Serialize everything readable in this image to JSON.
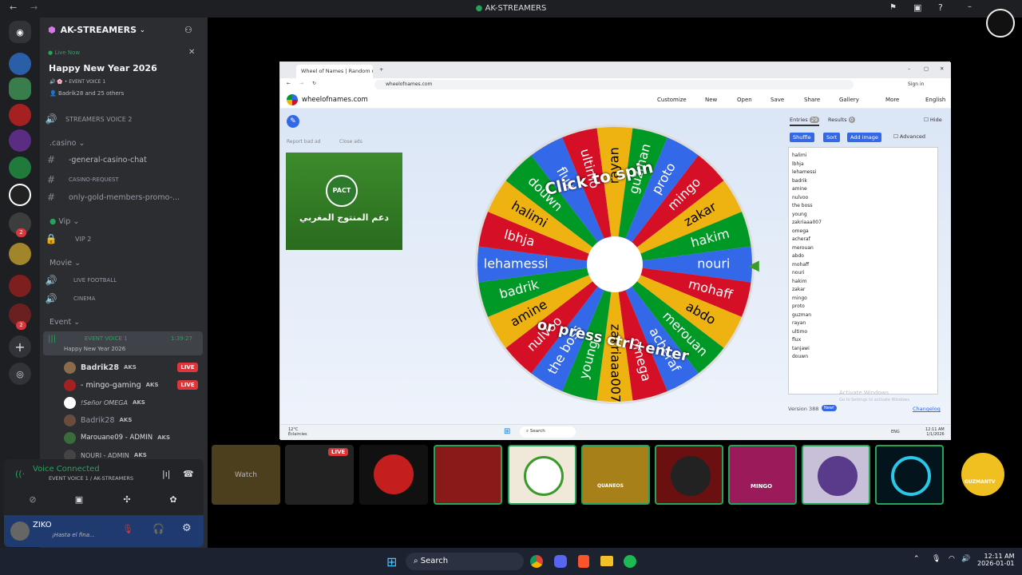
{
  "window": {
    "title": "AK-STREAMERS"
  },
  "server": {
    "name": "AK-STREAMERS"
  },
  "live_now": {
    "status": "Live Now",
    "event_title": "Happy New Year 2026",
    "channel": "EVENT VOICE 1",
    "participants": "Badrik28 and 25 others"
  },
  "channels": {
    "streamers_voice": "STREAMERS VOICE 2",
    "casino_category": ".casino",
    "casino_chat": "-general-casino-chat",
    "casino_request": "CASINO-REQUEST",
    "gold_promo": "only-gold-members-promo-...",
    "vip_category": "Vip",
    "vip2": "VIP 2",
    "movie_category": "Movie",
    "live_football": "LIVE FOOTBALL",
    "cinema": "CINEMA",
    "event_category": "Event",
    "event_voice": "EVENT VOICE 1",
    "event_timer": "1:39:27",
    "event_subtitle": "Happy New Year 2026"
  },
  "voice_users": [
    {
      "name": "Badrik28",
      "tag": "AKS",
      "live": "LIVE"
    },
    {
      "name": "- mingo-gaming",
      "tag": "AKS",
      "live": "LIVE"
    },
    {
      "name": "!Señor OMEGA",
      "tag": "AKS"
    },
    {
      "name": "Badrik28",
      "tag": "AKS"
    },
    {
      "name": "Marouane09 - ADMIN",
      "tag": "AKS"
    },
    {
      "name": "NOURI - ADMIN",
      "tag": "AKS"
    }
  ],
  "voice_panel": {
    "status": "Voice Connected",
    "channel": "EVENT VOICE 1 / AK-STREAMERS",
    "username": "ZIKO",
    "user_status": "¡Hasta el fina..."
  },
  "browser": {
    "tab": "Wheel of Names | Random nam",
    "url": "wheelofnames.com",
    "site": "wheelofnames.com",
    "sign_in": "Sign in",
    "menu": [
      "Customize",
      "New",
      "Open",
      "Save",
      "Share",
      "Gallery",
      "More",
      "English"
    ],
    "report_ad": "Report bad ad",
    "close_ads": "Close ads",
    "ad_title": "دعم المنتوج المغربي",
    "ad_brand": "PACT",
    "wheel_text_top": "Click to spin",
    "wheel_text_bottom": "or press ctrl+enter",
    "tabs": {
      "entries": "Entries",
      "entries_count": "29",
      "results": "Results",
      "results_count": "0",
      "hide": "Hide"
    },
    "buttons": {
      "shuffle": "Shuffle",
      "sort": "Sort",
      "add_image": "Add image",
      "advanced": "Advanced"
    },
    "entries": [
      "halimi",
      "lbhja",
      "lehamessi",
      "badrik",
      "amine",
      "nulvoo",
      "the boss",
      "young",
      "zakriaaa007",
      "omega",
      "acheraf",
      "merouan",
      "abdo",
      "mohaff",
      "nouri",
      "hakim",
      "zakar",
      "mingo",
      "proto",
      "guzman",
      "rayan",
      "ultimo",
      "flux",
      "tanjawi",
      "douwn"
    ],
    "version": "Version 388",
    "version_badge": "New!",
    "changelog": "Changelog",
    "activate": "Activate Windows",
    "activate_sub": "Go to Settings to activate Windows.",
    "inner_search": "Search",
    "inner_weather": "12°C",
    "inner_weather_sub": "Éclaircies",
    "inner_lang": "ENG",
    "inner_time": "12:11 AM",
    "inner_date": "1/1/2026"
  },
  "wheel_segments": [
    "flux",
    "ultimo",
    "rayan",
    "guzman",
    "proto",
    "mingo",
    "zakar",
    "hakim",
    "nouri",
    "mohaff",
    "abdo",
    "merouan",
    "acheraf",
    "omega",
    "zakriaaa007",
    "young",
    "the boss",
    "nulvoo",
    "amine",
    "badrik",
    "lehamessi",
    "lbhja",
    "halimi",
    "douwn"
  ],
  "wheel_colors": [
    "#3369e8",
    "#d50f25",
    "#eeb211",
    "#009925"
  ],
  "thumbs": {
    "watch": "Watch",
    "live": "LIVE",
    "names": [
      "QUANEOS",
      "MINGO",
      "GUZMANTV"
    ]
  },
  "taskbar": {
    "search": "Search",
    "time": "12:11 AM",
    "date": "2026-01-01"
  }
}
